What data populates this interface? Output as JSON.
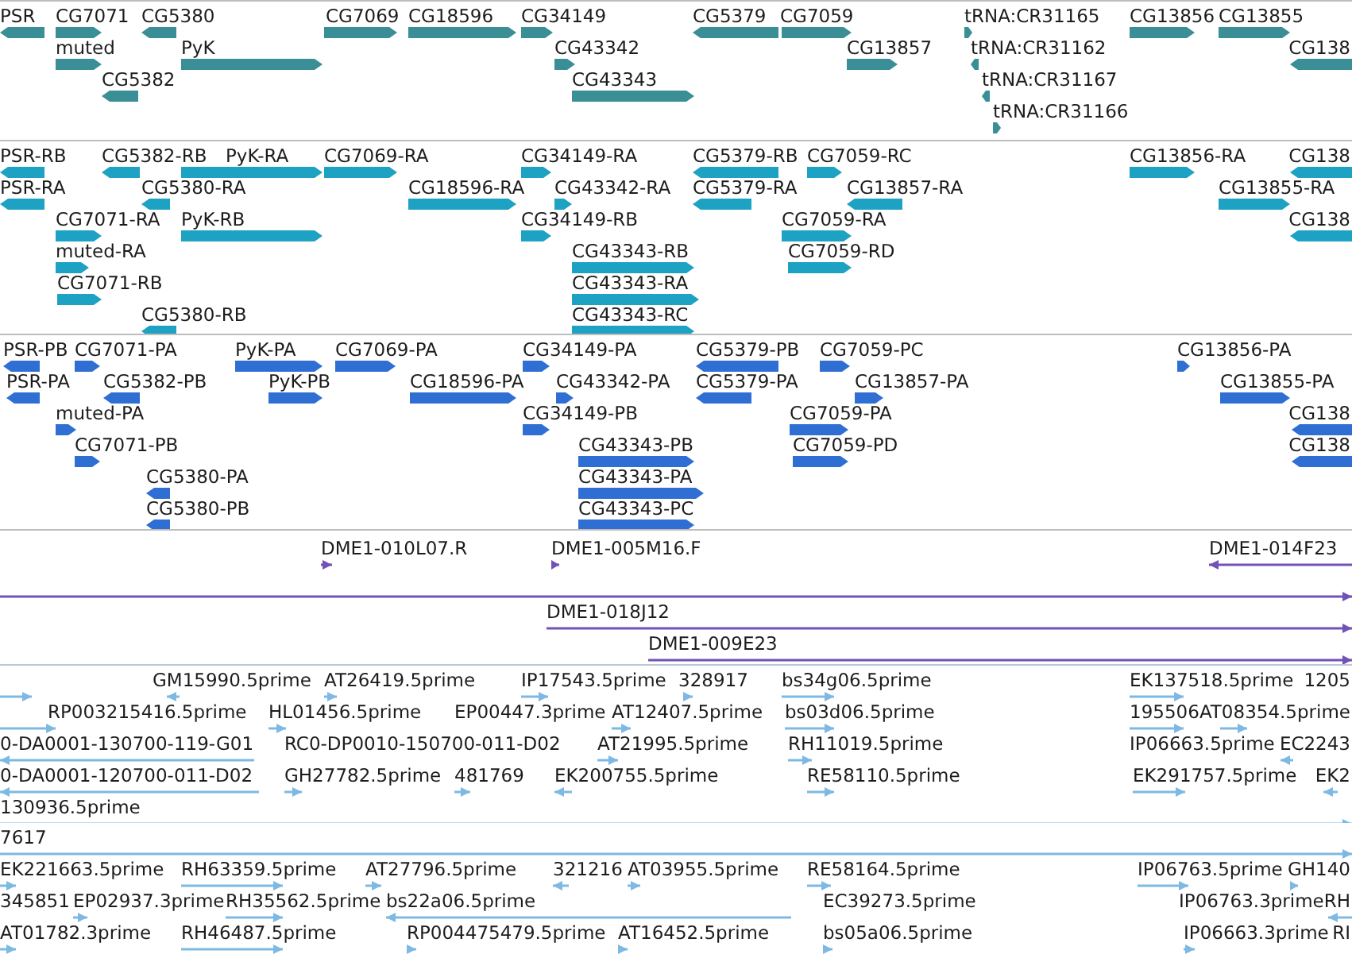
{
  "tracks": [
    {
      "kind": "bar",
      "color": "#3a8e96",
      "features": [
        {
          "label": "PSR",
          "reverse": true
        },
        {
          "label": "CG7071",
          "reverse": false
        },
        {
          "label": "CG5380",
          "reverse": true
        },
        {
          "label": "CG7069",
          "reverse": false
        },
        {
          "label": "CG18596",
          "reverse": false
        },
        {
          "label": "CG34149",
          "reverse": false
        },
        {
          "label": "CG5379",
          "reverse": true
        },
        {
          "label": "CG7059",
          "reverse": false
        },
        {
          "label": "tRNA:CR31165",
          "reverse": false
        },
        {
          "label": "CG13856",
          "reverse": false
        },
        {
          "label": "CG13855",
          "reverse": false
        },
        {
          "label": "muted",
          "reverse": false
        },
        {
          "label": "PyK",
          "reverse": false
        },
        {
          "label": "CG43342",
          "reverse": false
        },
        {
          "label": "CG13857",
          "reverse": false
        },
        {
          "label": "tRNA:CR31162",
          "reverse": true
        },
        {
          "label": "CG138",
          "reverse": true
        },
        {
          "label": "CG5382",
          "reverse": true
        },
        {
          "label": "CG43343",
          "reverse": false
        },
        {
          "label": "tRNA:CR31167",
          "reverse": true
        },
        {
          "label": "tRNA:CR31166",
          "reverse": false
        }
      ]
    },
    {
      "kind": "bar",
      "color": "#1ea2c4",
      "features": [
        {
          "label": "PSR-RB",
          "reverse": true
        },
        {
          "label": "CG5382-RB",
          "reverse": true
        },
        {
          "label": "PyK-RA",
          "reverse": false
        },
        {
          "label": "CG7069-RA",
          "reverse": false
        },
        {
          "label": "CG34149-RA",
          "reverse": false
        },
        {
          "label": "CG5379-RB",
          "reverse": true
        },
        {
          "label": "CG7059-RC",
          "reverse": false
        },
        {
          "label": "CG13856-RA",
          "reverse": false
        },
        {
          "label": "CG138",
          "reverse": true
        },
        {
          "label": "PSR-RA",
          "reverse": true
        },
        {
          "label": "CG5380-RA",
          "reverse": true
        },
        {
          "label": "CG18596-RA",
          "reverse": false
        },
        {
          "label": "CG43342-RA",
          "reverse": false
        },
        {
          "label": "CG5379-RA",
          "reverse": true
        },
        {
          "label": "CG13857-RA",
          "reverse": true
        },
        {
          "label": "CG13855-RA",
          "reverse": false
        },
        {
          "label": "CG7071-RA",
          "reverse": false
        },
        {
          "label": "PyK-RB",
          "reverse": false
        },
        {
          "label": "CG34149-RB",
          "reverse": false
        },
        {
          "label": "CG7059-RA",
          "reverse": false
        },
        {
          "label": "CG138",
          "reverse": true
        },
        {
          "label": "muted-RA",
          "reverse": false
        },
        {
          "label": "CG43343-RB",
          "reverse": false
        },
        {
          "label": "CG7059-RD",
          "reverse": false
        },
        {
          "label": "CG7071-RB",
          "reverse": false
        },
        {
          "label": "CG43343-RA",
          "reverse": false
        },
        {
          "label": "CG5380-RB",
          "reverse": true
        },
        {
          "label": "CG43343-RC",
          "reverse": false
        }
      ]
    },
    {
      "kind": "bar",
      "color": "#2f6fd4",
      "features": [
        {
          "label": "PSR-PB",
          "reverse": true
        },
        {
          "label": "CG7071-PA",
          "reverse": false
        },
        {
          "label": "PyK-PA",
          "reverse": false
        },
        {
          "label": "CG7069-PA",
          "reverse": false
        },
        {
          "label": "CG34149-PA",
          "reverse": false
        },
        {
          "label": "CG5379-PB",
          "reverse": true
        },
        {
          "label": "CG7059-PC",
          "reverse": false
        },
        {
          "label": "CG13856-PA",
          "reverse": false
        },
        {
          "label": "PSR-PA",
          "reverse": true
        },
        {
          "label": "CG5382-PB",
          "reverse": true
        },
        {
          "label": "PyK-PB",
          "reverse": false
        },
        {
          "label": "CG18596-PA",
          "reverse": false
        },
        {
          "label": "CG43342-PA",
          "reverse": false
        },
        {
          "label": "CG5379-PA",
          "reverse": true
        },
        {
          "label": "CG13857-PA",
          "reverse": false
        },
        {
          "label": "CG13855-PA",
          "reverse": false
        },
        {
          "label": "muted-PA",
          "reverse": false
        },
        {
          "label": "CG34149-PB",
          "reverse": false
        },
        {
          "label": "CG7059-PA",
          "reverse": false
        },
        {
          "label": "CG138",
          "reverse": true
        },
        {
          "label": "CG7071-PB",
          "reverse": false
        },
        {
          "label": "CG43343-PB",
          "reverse": false
        },
        {
          "label": "CG7059-PD",
          "reverse": false
        },
        {
          "label": "CG138",
          "reverse": true
        },
        {
          "label": "CG5380-PA",
          "reverse": true
        },
        {
          "label": "CG43343-PA",
          "reverse": false
        },
        {
          "label": "CG5380-PB",
          "reverse": true
        },
        {
          "label": "CG43343-PC",
          "reverse": false
        }
      ]
    },
    {
      "kind": "line",
      "color": "#7352b8",
      "features": [
        {
          "label": "DME1-010L07.R",
          "reverse": false
        },
        {
          "label": "DME1-005M16.F",
          "reverse": false
        },
        {
          "label": "DME1-014F23",
          "reverse": true
        },
        {
          "reverse": false
        },
        {
          "label": "DME1-018J12",
          "reverse": false
        },
        {
          "label": "DME1-009E23",
          "reverse": false
        }
      ]
    },
    {
      "kind": "line",
      "color": "#7db9e3",
      "features": [
        {
          "reverse": false
        },
        {
          "label": "GM15990.5prime",
          "reverse": true
        },
        {
          "label": "AT26419.5prime",
          "reverse": false
        },
        {
          "label": "IP17543.5prime",
          "reverse": false
        },
        {
          "label": "328917",
          "reverse": false
        },
        {
          "label": "bs34g06.5prime",
          "reverse": false
        },
        {
          "label": "EK137518.5prime",
          "reverse": false
        },
        {
          "label": "1205"
        },
        {
          "label": "RP003215416.5prime",
          "reverse": false
        },
        {
          "label": "HL01456.5prime",
          "reverse": false
        },
        {
          "label": "EP00447.3prime"
        },
        {
          "label": "AT12407.5prime",
          "reverse": false
        },
        {
          "label": "bs03d06.5prime",
          "reverse": false
        },
        {
          "label": "195506",
          "reverse": false
        },
        {
          "label": "AT08354.5prime",
          "reverse": false
        },
        {
          "label": "0-DA0001-130700-119-G01",
          "reverse": true
        },
        {
          "label": "RC0-DP0010-150700-011-D02"
        },
        {
          "label": "AT21995.5prime",
          "reverse": false
        },
        {
          "label": "RH11019.5prime",
          "reverse": false
        },
        {
          "label": "IP06663.5prime"
        },
        {
          "label": "EC2243",
          "reverse": true
        },
        {
          "label": "0-DA0001-120700-011-D02",
          "reverse": true
        },
        {
          "label": "GH27782.5prime",
          "reverse": false
        },
        {
          "label": "481769",
          "reverse": false
        },
        {
          "label": "EK200755.5prime",
          "reverse": true
        },
        {
          "label": "RE58110.5prime",
          "reverse": false
        },
        {
          "label": "EK291757.5prime",
          "reverse": false
        },
        {
          "label": "EK2",
          "reverse": true
        },
        {
          "label": "130936.5prime",
          "reverse": false
        }
      ]
    },
    {
      "kind": "line",
      "color": "#7db9e3",
      "features": [
        {
          "label": "7617",
          "reverse": false
        },
        {
          "label": "EK221663.5prime",
          "reverse": false
        },
        {
          "label": "RH63359.5prime",
          "reverse": false
        },
        {
          "label": "AT27796.5prime",
          "reverse": false
        },
        {
          "label": "321216",
          "reverse": true
        },
        {
          "label": "AT03955.5prime",
          "reverse": false
        },
        {
          "label": "RE58164.5prime",
          "reverse": false
        },
        {
          "label": "IP06763.5prime",
          "reverse": false
        },
        {
          "label": "GH140",
          "reverse": false
        },
        {
          "label": "345851"
        },
        {
          "label": "EP02937.3prime",
          "reverse": false
        },
        {
          "label": "RH35562.5prime",
          "reverse": false
        },
        {
          "label": "bs22a06.5prime",
          "reverse": true
        },
        {
          "label": "EC39273.5prime"
        },
        {
          "label": "IP06763.3prime"
        },
        {
          "label": "RH",
          "reverse": true
        },
        {
          "label": "AT01782.3prime",
          "reverse": false
        },
        {
          "label": "RH46487.5prime",
          "reverse": false
        },
        {
          "label": "RP004475479.5prime",
          "reverse": false
        },
        {
          "label": "AT16452.5prime",
          "reverse": false
        },
        {
          "label": "bs05a06.5prime",
          "reverse": false
        },
        {
          "label": "IP06663.3prime",
          "reverse": false
        },
        {
          "label": "RI"
        }
      ]
    }
  ]
}
